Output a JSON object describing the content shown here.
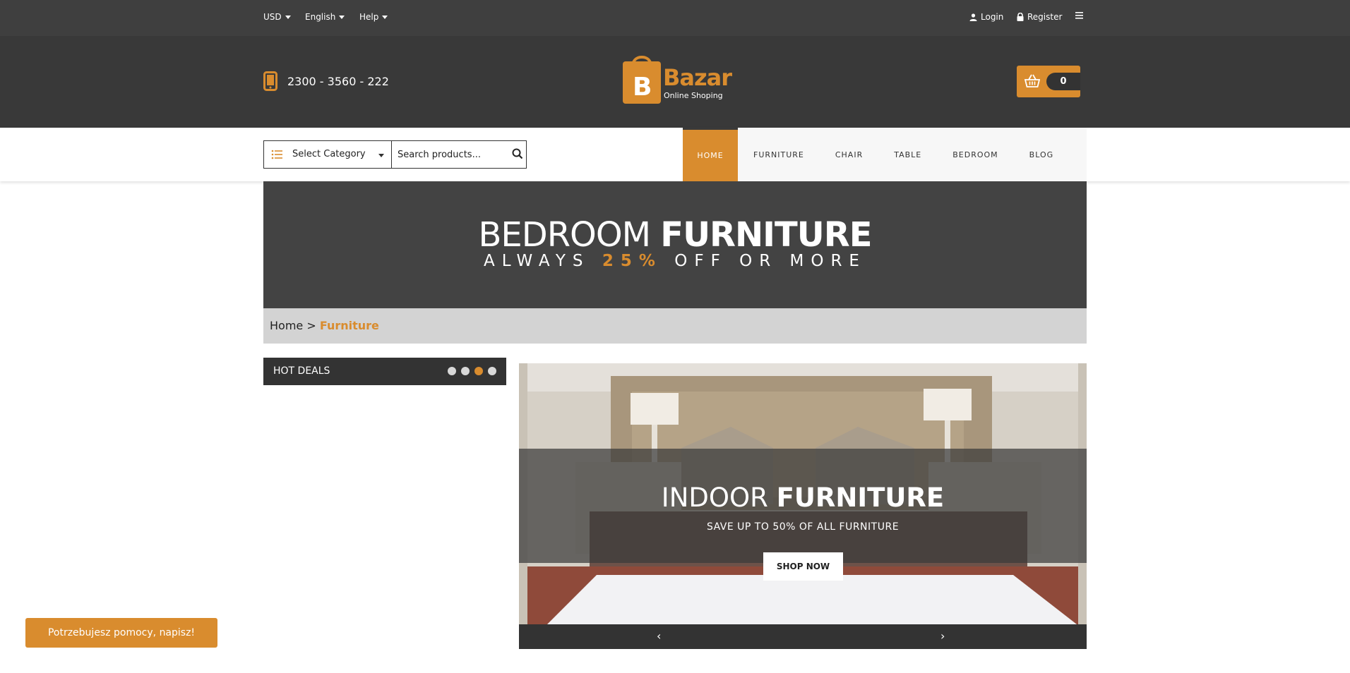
{
  "topbar": {
    "currency": "USD",
    "language": "English",
    "help": "Help",
    "login": "Login",
    "register": "Register"
  },
  "header": {
    "phone": "2300 - 3560 - 222",
    "logo_letter": "B",
    "logo_name": "Bazar",
    "logo_tagline": "Online Shoping",
    "cart_count": "0"
  },
  "nav": {
    "category_label": "Select Category",
    "search_placeholder": "Search products...",
    "menu": [
      {
        "label": "HOME",
        "active": true
      },
      {
        "label": "FURNITURE"
      },
      {
        "label": "CHAIR"
      },
      {
        "label": "TABLE"
      },
      {
        "label": "BEDROOM"
      },
      {
        "label": "BLOG"
      }
    ]
  },
  "banner": {
    "title_light": "BEDROOM ",
    "title_bold": "FURNITURE",
    "sub_pre": "ALWAYS ",
    "sub_accent": "25%",
    "sub_post": " OFF OR MORE"
  },
  "breadcrumb": {
    "home": "Home",
    "separator": " > ",
    "current": "Furniture"
  },
  "hot_deals": {
    "title": "HOT DEALS",
    "active_dot_index": 2
  },
  "slider": {
    "title_light": "INDOOR ",
    "title_bold": "FURNITURE",
    "subtitle": "SAVE UP TO 50% OF ALL FURNITURE",
    "button": "SHOP NOW",
    "prev": "‹",
    "next": "›"
  },
  "help_button": "Potrzebujesz pomocy, napisz!",
  "colors": {
    "accent": "#d98c2e",
    "dark": "#393939",
    "topbar": "#3f3f3f"
  }
}
